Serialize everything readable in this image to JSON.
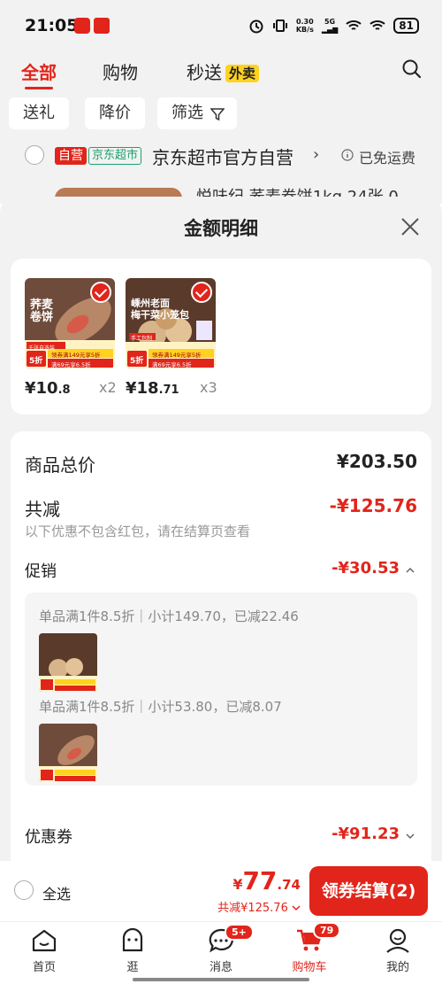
{
  "status_bar": {
    "time": "21:05",
    "network_speed": "0.30",
    "network_unit": "KB/s",
    "signal": "5G",
    "battery": "81"
  },
  "top_tabs": [
    {
      "label": "全部"
    },
    {
      "label": "购物"
    },
    {
      "label": "秒送"
    }
  ],
  "waimai_tag": "外卖",
  "filters": [
    {
      "label": "送礼"
    },
    {
      "label": "降价"
    },
    {
      "label": "筛选"
    }
  ],
  "store": {
    "tag_self": "自营",
    "tag_market": "京东超市",
    "name": "京东超市官方自营",
    "shipping": "已免运费"
  },
  "peek_item_text": "悦味纪 荞麦卷饼1kg 24张 0",
  "sheet": {
    "title": "金额明细",
    "items": [
      {
        "image_title": "荞麦\n卷饼",
        "price_int": "¥10",
        "price_dec": ".8",
        "qty": "x2",
        "discount": "5折",
        "promo": "领券满149元享5折",
        "promo2": "满69元享6.5折",
        "tag": "千张自选装"
      },
      {
        "image_title": "嵊州老面\n梅干菜小笼包",
        "price_int": "¥18",
        "price_dec": ".71",
        "qty": "x3",
        "discount": "5折",
        "promo": "领券满149元享5折",
        "promo2": "满69元享6.5折",
        "tag": "手工包制"
      }
    ],
    "total_label": "商品总价",
    "total_value": "¥203.50",
    "reduce_label": "共减",
    "reduce_value": "-¥125.76",
    "reduce_note": "以下优惠不包含红包，请在结算页查看",
    "promo_label": "促销",
    "promo_value": "-¥30.53",
    "promo_lines": [
      "单品满1件8.5折｜小计149.70，已减22.46",
      "单品满1件8.5折｜小计53.80，已减8.07"
    ],
    "coupon_label": "优惠券",
    "coupon_value": "-¥91.23"
  },
  "action_bar": {
    "select_all": "全选",
    "total_symbol": "¥",
    "total_int": "77",
    "total_dec": ".74",
    "total_reduce": "共减¥125.76",
    "checkout_label": "领券结算(2)"
  },
  "nav": [
    {
      "label": "首页",
      "icon": "home-icon"
    },
    {
      "label": "逛",
      "icon": "explore-icon"
    },
    {
      "label": "消息",
      "icon": "message-icon",
      "badge": "5+"
    },
    {
      "label": "购物车",
      "icon": "cart-icon",
      "badge": "79"
    },
    {
      "label": "我的",
      "icon": "profile-icon"
    }
  ],
  "colors": {
    "accent": "#e1251b",
    "bg": "#f2f2f2",
    "waimai": "#ffd21f",
    "green": "#1aa36e"
  }
}
